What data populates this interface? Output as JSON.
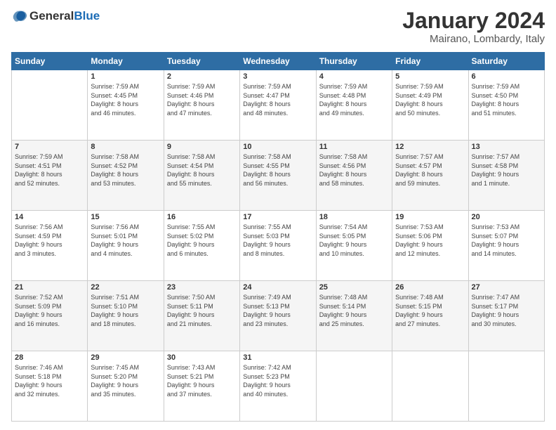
{
  "header": {
    "logo_general": "General",
    "logo_blue": "Blue",
    "month": "January 2024",
    "location": "Mairano, Lombardy, Italy"
  },
  "weekdays": [
    "Sunday",
    "Monday",
    "Tuesday",
    "Wednesday",
    "Thursday",
    "Friday",
    "Saturday"
  ],
  "weeks": [
    [
      {
        "day": "",
        "info": ""
      },
      {
        "day": "1",
        "info": "Sunrise: 7:59 AM\nSunset: 4:45 PM\nDaylight: 8 hours\nand 46 minutes."
      },
      {
        "day": "2",
        "info": "Sunrise: 7:59 AM\nSunset: 4:46 PM\nDaylight: 8 hours\nand 47 minutes."
      },
      {
        "day": "3",
        "info": "Sunrise: 7:59 AM\nSunset: 4:47 PM\nDaylight: 8 hours\nand 48 minutes."
      },
      {
        "day": "4",
        "info": "Sunrise: 7:59 AM\nSunset: 4:48 PM\nDaylight: 8 hours\nand 49 minutes."
      },
      {
        "day": "5",
        "info": "Sunrise: 7:59 AM\nSunset: 4:49 PM\nDaylight: 8 hours\nand 50 minutes."
      },
      {
        "day": "6",
        "info": "Sunrise: 7:59 AM\nSunset: 4:50 PM\nDaylight: 8 hours\nand 51 minutes."
      }
    ],
    [
      {
        "day": "7",
        "info": "Sunrise: 7:59 AM\nSunset: 4:51 PM\nDaylight: 8 hours\nand 52 minutes."
      },
      {
        "day": "8",
        "info": "Sunrise: 7:58 AM\nSunset: 4:52 PM\nDaylight: 8 hours\nand 53 minutes."
      },
      {
        "day": "9",
        "info": "Sunrise: 7:58 AM\nSunset: 4:54 PM\nDaylight: 8 hours\nand 55 minutes."
      },
      {
        "day": "10",
        "info": "Sunrise: 7:58 AM\nSunset: 4:55 PM\nDaylight: 8 hours\nand 56 minutes."
      },
      {
        "day": "11",
        "info": "Sunrise: 7:58 AM\nSunset: 4:56 PM\nDaylight: 8 hours\nand 58 minutes."
      },
      {
        "day": "12",
        "info": "Sunrise: 7:57 AM\nSunset: 4:57 PM\nDaylight: 8 hours\nand 59 minutes."
      },
      {
        "day": "13",
        "info": "Sunrise: 7:57 AM\nSunset: 4:58 PM\nDaylight: 9 hours\nand 1 minute."
      }
    ],
    [
      {
        "day": "14",
        "info": "Sunrise: 7:56 AM\nSunset: 4:59 PM\nDaylight: 9 hours\nand 3 minutes."
      },
      {
        "day": "15",
        "info": "Sunrise: 7:56 AM\nSunset: 5:01 PM\nDaylight: 9 hours\nand 4 minutes."
      },
      {
        "day": "16",
        "info": "Sunrise: 7:55 AM\nSunset: 5:02 PM\nDaylight: 9 hours\nand 6 minutes."
      },
      {
        "day": "17",
        "info": "Sunrise: 7:55 AM\nSunset: 5:03 PM\nDaylight: 9 hours\nand 8 minutes."
      },
      {
        "day": "18",
        "info": "Sunrise: 7:54 AM\nSunset: 5:05 PM\nDaylight: 9 hours\nand 10 minutes."
      },
      {
        "day": "19",
        "info": "Sunrise: 7:53 AM\nSunset: 5:06 PM\nDaylight: 9 hours\nand 12 minutes."
      },
      {
        "day": "20",
        "info": "Sunrise: 7:53 AM\nSunset: 5:07 PM\nDaylight: 9 hours\nand 14 minutes."
      }
    ],
    [
      {
        "day": "21",
        "info": "Sunrise: 7:52 AM\nSunset: 5:09 PM\nDaylight: 9 hours\nand 16 minutes."
      },
      {
        "day": "22",
        "info": "Sunrise: 7:51 AM\nSunset: 5:10 PM\nDaylight: 9 hours\nand 18 minutes."
      },
      {
        "day": "23",
        "info": "Sunrise: 7:50 AM\nSunset: 5:11 PM\nDaylight: 9 hours\nand 21 minutes."
      },
      {
        "day": "24",
        "info": "Sunrise: 7:49 AM\nSunset: 5:13 PM\nDaylight: 9 hours\nand 23 minutes."
      },
      {
        "day": "25",
        "info": "Sunrise: 7:48 AM\nSunset: 5:14 PM\nDaylight: 9 hours\nand 25 minutes."
      },
      {
        "day": "26",
        "info": "Sunrise: 7:48 AM\nSunset: 5:15 PM\nDaylight: 9 hours\nand 27 minutes."
      },
      {
        "day": "27",
        "info": "Sunrise: 7:47 AM\nSunset: 5:17 PM\nDaylight: 9 hours\nand 30 minutes."
      }
    ],
    [
      {
        "day": "28",
        "info": "Sunrise: 7:46 AM\nSunset: 5:18 PM\nDaylight: 9 hours\nand 32 minutes."
      },
      {
        "day": "29",
        "info": "Sunrise: 7:45 AM\nSunset: 5:20 PM\nDaylight: 9 hours\nand 35 minutes."
      },
      {
        "day": "30",
        "info": "Sunrise: 7:43 AM\nSunset: 5:21 PM\nDaylight: 9 hours\nand 37 minutes."
      },
      {
        "day": "31",
        "info": "Sunrise: 7:42 AM\nSunset: 5:23 PM\nDaylight: 9 hours\nand 40 minutes."
      },
      {
        "day": "",
        "info": ""
      },
      {
        "day": "",
        "info": ""
      },
      {
        "day": "",
        "info": ""
      }
    ]
  ]
}
